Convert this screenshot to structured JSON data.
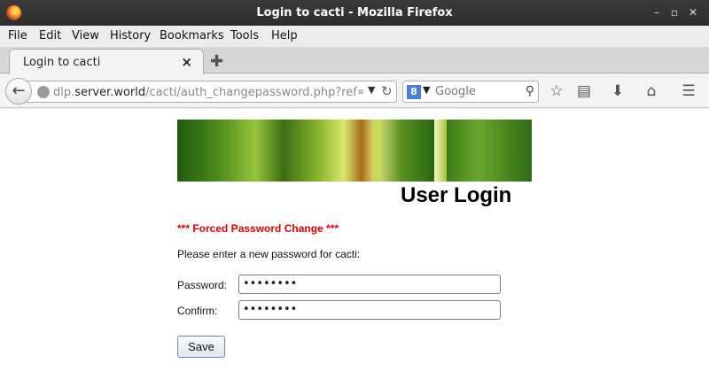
{
  "window": {
    "title": "Login to cacti - Mozilla Firefox"
  },
  "menu": [
    "File",
    "Edit",
    "View",
    "History",
    "Bookmarks",
    "Tools",
    "Help"
  ],
  "tab": {
    "title": "Login to cacti",
    "close": "×",
    "new_tab": "✚"
  },
  "nav": {
    "url_prefix": "dlp.",
    "url_host": "server.world",
    "url_path": "/cacti/auth_changepassword.php?ref=http://(",
    "search_placeholder": "Google",
    "search_engine_letter": "8"
  },
  "page": {
    "heading": "User Login",
    "forced_notice": "*** Forced Password Change ***",
    "instruction": "Please enter a new password for cacti:",
    "password_label": "Password:",
    "password_value": "••••••••",
    "confirm_label": "Confirm:",
    "confirm_value": "••••••••",
    "save_label": "Save"
  }
}
